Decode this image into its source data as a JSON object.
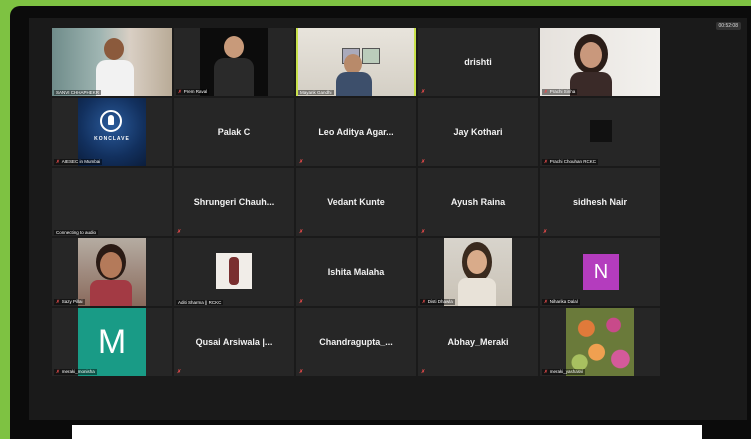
{
  "meeting": {
    "badge": "00:52:08"
  },
  "tiles": {
    "t0": {
      "label": "SANVI CHHAPHEKR"
    },
    "t1": {
      "label": "Prem Raval"
    },
    "t2": {
      "label": "Mayank Gandhi"
    },
    "t3": {
      "name": "drishti"
    },
    "t4": {
      "label": "Prachi Sinha"
    },
    "t5": {
      "label": "AIESEC in Mumbai"
    },
    "t6": {
      "name": "Palak C"
    },
    "t7": {
      "name": "Leo Aditya Agar..."
    },
    "t8": {
      "name": "Jay Kothari"
    },
    "t9": {
      "label": "Prachi Chouhan RCKC"
    },
    "t10": {
      "label": "Connecting to audio"
    },
    "t11": {
      "name": "Shrungeri  Chauh..."
    },
    "t12": {
      "name": "Vedant Kunte"
    },
    "t13": {
      "name": "Ayush Raina"
    },
    "t14": {
      "name": "sidhesh Nair"
    },
    "t15": {
      "label": "Sazy Pillai"
    },
    "t16": {
      "label": "Aditi Sharma || RCKC"
    },
    "t17": {
      "name": "Ishita Malaha"
    },
    "t18": {
      "label": "Disti Dhawla"
    },
    "t19": {
      "label": "Niharika Dalal",
      "letter": "N",
      "color": "#b43cbe"
    },
    "t20": {
      "label": "meraki_monisha",
      "letter": "M",
      "color": "#199b86"
    },
    "t21": {
      "name": "Qusai Arsiwala |..."
    },
    "t22": {
      "name": "Chandragupta_..."
    },
    "t23": {
      "name": "Abhay_Meraki"
    },
    "t24": {
      "label": "meraki_yashasvi"
    }
  },
  "icons": {
    "mic_muted": "✗",
    "conklave_logo_text": "KONCLAVE"
  }
}
